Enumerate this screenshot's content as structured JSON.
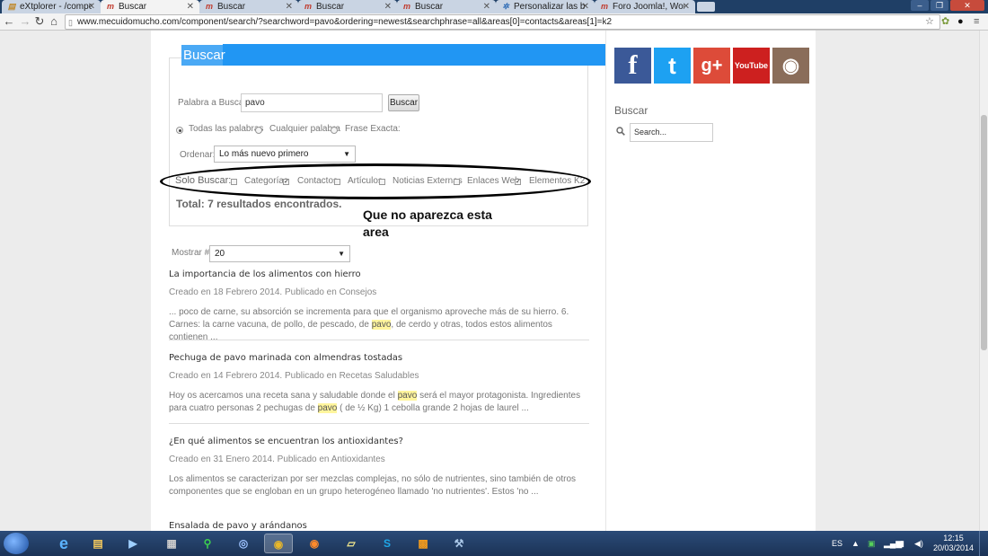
{
  "browser": {
    "tabs": [
      {
        "title": "eXtplorer - /compo",
        "icon": "folder-icon"
      },
      {
        "title": "Buscar",
        "icon": "joomla-m-icon",
        "active": true
      },
      {
        "title": "Buscar",
        "icon": "joomla-m-icon"
      },
      {
        "title": "Buscar",
        "icon": "joomla-m-icon"
      },
      {
        "title": "Personalizar las búsq",
        "icon": "joomla-j-icon"
      },
      {
        "title": "Foro Joomla!, Word!",
        "icon": "joomla-m-icon"
      }
    ],
    "url": "www.mecuidomucho.com/component/search/?searchword=pavo&ordering=newest&searchphrase=all&areas[0]=contacts&areas[1]=k2"
  },
  "search_form": {
    "legend": "Buscar",
    "keyword_label": "Palabra a Buscar:",
    "keyword_value": "pavo",
    "search_button": "Buscar",
    "phrase_options": [
      {
        "label": "Todas las palabras",
        "checked": true
      },
      {
        "label": "Cualquier palabra",
        "checked": false
      },
      {
        "label": "Frase Exacta:",
        "checked": false
      }
    ],
    "order_label": "Ordenar:",
    "order_value": "Lo más nuevo primero",
    "areas_label": "Solo Buscar:",
    "areas": [
      {
        "label": "Categorías",
        "checked": false
      },
      {
        "label": "Contactos",
        "checked": true
      },
      {
        "label": "Artículos",
        "checked": false
      },
      {
        "label": "Noticias Externas",
        "checked": false
      },
      {
        "label": "Enlaces Web",
        "checked": false
      },
      {
        "label": "Elementos K2",
        "checked": true
      }
    ],
    "total": "Total: 7 resultados encontrados.",
    "annotation": "Que no aparezca esta area",
    "show_label": "Mostrar #",
    "show_value": "20"
  },
  "results": [
    {
      "title": "La importancia de los alimentos con hierro",
      "meta": "Creado en 18 Febrero 2014. Publicado en Consejos",
      "snippet_before": "... poco de carne, su absorción se incrementa para que el organismo aproveche más de su hierro. 6. Carnes: la carne vacuna, de pollo, de pescado, de ",
      "highlight": "pavo",
      "snippet_after": ", de cerdo y otras, todos estos alimentos contienen ..."
    },
    {
      "title": "Pechuga de pavo marinada con almendras tostadas",
      "meta": "Creado en 14 Febrero 2014. Publicado en Recetas Saludables",
      "snippet_before": " Hoy os acercamos una receta sana y saludable donde el ",
      "highlight": "pavo",
      "snippet_mid": " será el mayor protagonista. Ingredientes para cuatro personas 2 pechugas de ",
      "highlight2": "pavo",
      "snippet_after": " ( de ½ Kg) 1 cebolla grande 2 hojas de laurel ..."
    },
    {
      "title": "¿En qué alimentos se encuentran los antioxidantes?",
      "meta": "Creado en 31 Enero 2014. Publicado en Antioxidantes",
      "snippet_before": " Los alimentos se caracterizan por ser mezclas complejas, no sólo de nutrientes, sino también de otros componentes que se engloban en un grupo heterogéneo llamado 'no nutrientes'. Estos 'no ..."
    },
    {
      "title": "Ensalada de pavo y arándanos"
    }
  ],
  "sidebar": {
    "social": [
      {
        "name": "facebook",
        "glyph": "f",
        "color": "#3b5998"
      },
      {
        "name": "twitter",
        "glyph": "t",
        "color": "#1da1f2"
      },
      {
        "name": "google-plus",
        "glyph": "g+",
        "color": "#dd4b39"
      },
      {
        "name": "youtube",
        "glyph": "YouTube",
        "color": "#cd201f"
      },
      {
        "name": "instagram",
        "glyph": "◉",
        "color": "#8a6d5a"
      }
    ],
    "search_title": "Buscar",
    "search_placeholder": "Search..."
  },
  "taskbar": {
    "language": "ES",
    "time": "12:15",
    "date": "20/03/2014"
  }
}
